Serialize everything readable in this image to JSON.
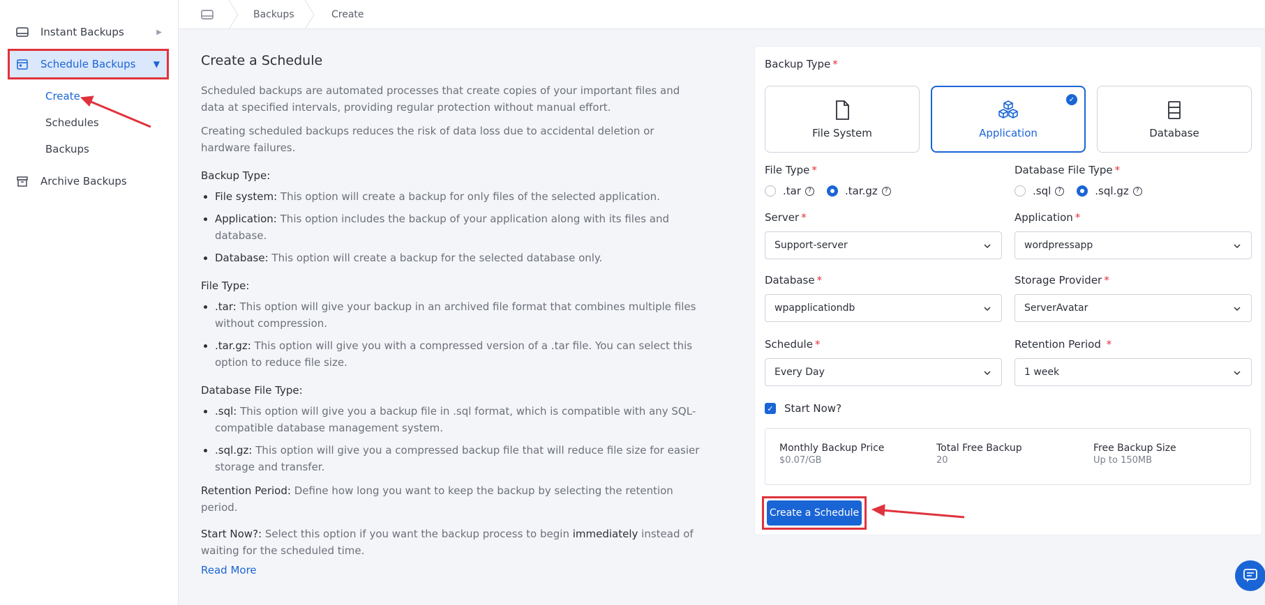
{
  "sidebar": {
    "items": [
      {
        "label": "Instant Backups",
        "icon": "drive-icon"
      },
      {
        "label": "Schedule Backups",
        "icon": "calendar-icon"
      },
      {
        "label": "Archive Backups",
        "icon": "archive-icon"
      }
    ],
    "sub_items": [
      {
        "label": "Create"
      },
      {
        "label": "Schedules"
      },
      {
        "label": "Backups"
      }
    ]
  },
  "breadcrumb": {
    "items": [
      "Backups",
      "Create"
    ]
  },
  "info": {
    "title": "Create a Schedule",
    "p1": "Scheduled backups are automated processes that create copies of your important files and data at specified intervals, providing regular protection without manual effort.",
    "p2": "Creating scheduled backups reduces the risk of data loss due to accidental deletion or hardware failures.",
    "backup_type_heading": "Backup Type:",
    "backup_types": [
      {
        "name": "File system:",
        "desc": " This option will create a backup for only files of the selected application."
      },
      {
        "name": "Application:",
        "desc": " This option includes the backup of your application along with its files and database."
      },
      {
        "name": "Database:",
        "desc": " This option will create a backup for the selected database only."
      }
    ],
    "file_type_heading": "File Type:",
    "file_types": [
      {
        "name": ".tar:",
        "desc": " This option will give your backup in an archived file format that combines multiple files without compression."
      },
      {
        "name": ".tar.gz:",
        "desc": " This option will give you with a compressed version of a .tar file. You can select this option to reduce file size."
      }
    ],
    "db_file_type_heading": "Database File Type:",
    "db_file_types": [
      {
        "name": ".sql:",
        "desc": " This option will give you a backup file in .sql format, which is compatible with any SQL-compatible database management system."
      },
      {
        "name": ".sql.gz:",
        "desc": " This option will give you a compressed backup file that will reduce file size for easier storage and transfer."
      }
    ],
    "retention_name": "Retention Period:",
    "retention_desc": " Define how long you want to keep the backup by selecting the retention period.",
    "startnow_name": "Start Now?:",
    "startnow_desc_a": " Select this option if you want the backup process to begin ",
    "startnow_emph": "immediately",
    "startnow_desc_b": " instead of waiting for the scheduled time.",
    "read_more": "Read More"
  },
  "form": {
    "backup_type_label": "Backup Type",
    "tiles": [
      {
        "label": "File System",
        "selected": false
      },
      {
        "label": "Application",
        "selected": true
      },
      {
        "label": "Database",
        "selected": false
      }
    ],
    "file_type_label": "File Type",
    "file_type_options": [
      ".tar",
      ".tar.gz"
    ],
    "file_type_selected": ".tar.gz",
    "db_file_type_label": "Database File Type",
    "db_file_type_options": [
      ".sql",
      ".sql.gz"
    ],
    "db_file_type_selected": ".sql.gz",
    "server_label": "Server",
    "server_value": "Support-server",
    "application_label": "Application",
    "application_value": "wordpressapp",
    "database_label": "Database",
    "database_value": "wpapplicationdb",
    "storage_label": "Storage Provider",
    "storage_value": "ServerAvatar",
    "schedule_label": "Schedule",
    "schedule_value": "Every Day",
    "retention_label": "Retention Period",
    "retention_value": "1 week",
    "start_now_label": "Start Now?",
    "start_now_checked": true,
    "pricing": [
      {
        "label": "Monthly Backup Price",
        "value": "$0.07/GB"
      },
      {
        "label": "Total Free Backup",
        "value": "20"
      },
      {
        "label": "Free Backup Size",
        "value": "Up to 150MB"
      }
    ],
    "submit_label": "Create a Schedule",
    "required_mark": "*"
  },
  "colors": {
    "accent": "#1a65d6",
    "highlight": "#e0323c"
  }
}
